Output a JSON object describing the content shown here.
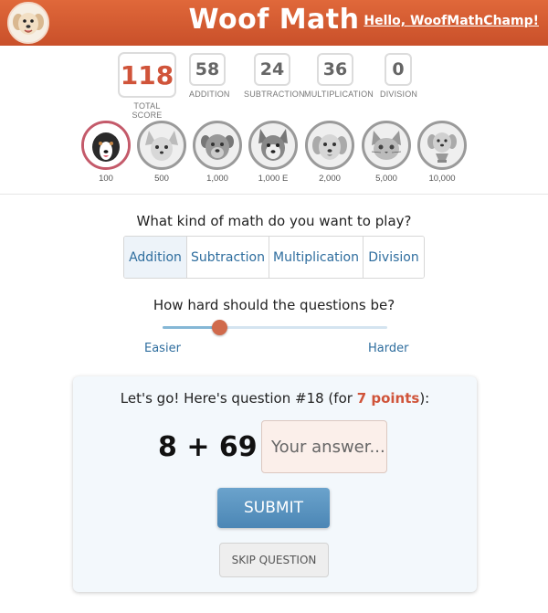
{
  "header": {
    "title": "Woof Math",
    "greeting": "Hello, WoofMathChamp!",
    "logo_icon": "dog-logo-icon",
    "accent_color": "#d65c31"
  },
  "stats": {
    "total": {
      "value": "118",
      "label": "TOTAL SCORE"
    },
    "items": [
      {
        "value": "58",
        "label": "ADDITION"
      },
      {
        "value": "24",
        "label": "SUBTRACTION"
      },
      {
        "value": "36",
        "label": "MULTIPLICATION"
      },
      {
        "value": "0",
        "label": "DIVISION"
      }
    ]
  },
  "badges": [
    {
      "label": "100",
      "icon": "bernese-dog-icon",
      "earned": true
    },
    {
      "label": "500",
      "icon": "chihuahua-dog-icon",
      "earned": false
    },
    {
      "label": "1,000",
      "icon": "rottweiler-dog-icon",
      "earned": false
    },
    {
      "label": "1,000 E",
      "icon": "husky-dog-icon",
      "earned": false
    },
    {
      "label": "2,000",
      "icon": "golden-retriever-icon",
      "earned": false
    },
    {
      "label": "5,000",
      "icon": "cat-icon",
      "earned": false
    },
    {
      "label": "10,000",
      "icon": "trophy-dog-icon",
      "earned": false
    }
  ],
  "math_type": {
    "prompt": "What kind of math do you want to play?",
    "options": [
      "Addition",
      "Subtraction",
      "Multiplication",
      "Division"
    ],
    "selected": "Addition"
  },
  "difficulty": {
    "prompt": "How hard should the questions be?",
    "easier_label": "Easier",
    "harder_label": "Harder",
    "level": 0.25
  },
  "question": {
    "prompt_start": "Let's go! Here's question #18 (for ",
    "points": "7 points",
    "prompt_end": "):",
    "problem": "8 + 69 =",
    "answer_value": "",
    "answer_placeholder": "Your answer...",
    "submit_label": "SUBMIT",
    "skip_label": "SKIP QUESTION"
  }
}
